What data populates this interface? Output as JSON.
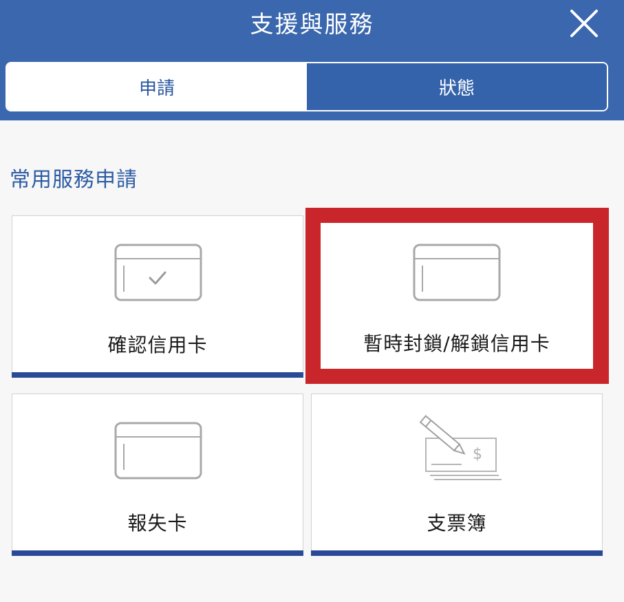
{
  "header": {
    "title": "支援與服務",
    "close_icon": "close-icon"
  },
  "tabs": [
    {
      "label": "申請",
      "active": true
    },
    {
      "label": "狀態",
      "active": false
    }
  ],
  "section": {
    "title": "常用服務申請"
  },
  "services": [
    {
      "label": "確認信用卡",
      "icon": "card-check-icon"
    },
    {
      "label": "暫時封鎖/解鎖信用卡",
      "icon": "card-icon",
      "highlighted": true
    },
    {
      "label": "報失卡",
      "icon": "card-icon"
    },
    {
      "label": "支票簿",
      "icon": "cheque-book-icon"
    }
  ],
  "colors": {
    "header_bg": "#3a67ad",
    "accent_bar": "#2a4a98",
    "highlight": "#c8262a",
    "section_title": "#2c5ba4"
  }
}
